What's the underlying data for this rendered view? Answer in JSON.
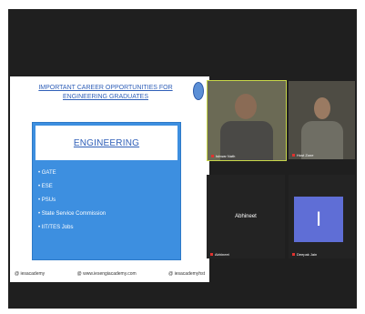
{
  "slide": {
    "title_line1": "IMPORTANT CAREER OPPORTUNITIES FOR",
    "title_line2": "ENGINEERING GRADUATES",
    "card_title": "ENGINEERING",
    "items": [
      "• GATE",
      "• ESE",
      "• PSUs",
      "• State Service Commission",
      "• IIT/TES Jobs"
    ],
    "footer_left": "@ iesacademy",
    "footer_center": "@ www.iesengiacademy.com",
    "footer_right": "@ iesacademyhst"
  },
  "participants": [
    {
      "label": "Ishwar Nath"
    },
    {
      "label": "Host Zone"
    },
    {
      "name": "Abhineet",
      "label": "Abhineet"
    },
    {
      "avatar_letter": "I",
      "label": "Deepak Jain"
    }
  ],
  "colors": {
    "frame": "#1f1f1f",
    "card": "#3d8fe0",
    "title": "#2f5fb8",
    "active_speaker_border": "#c9d84a",
    "avatar": "#5f6ed6"
  }
}
